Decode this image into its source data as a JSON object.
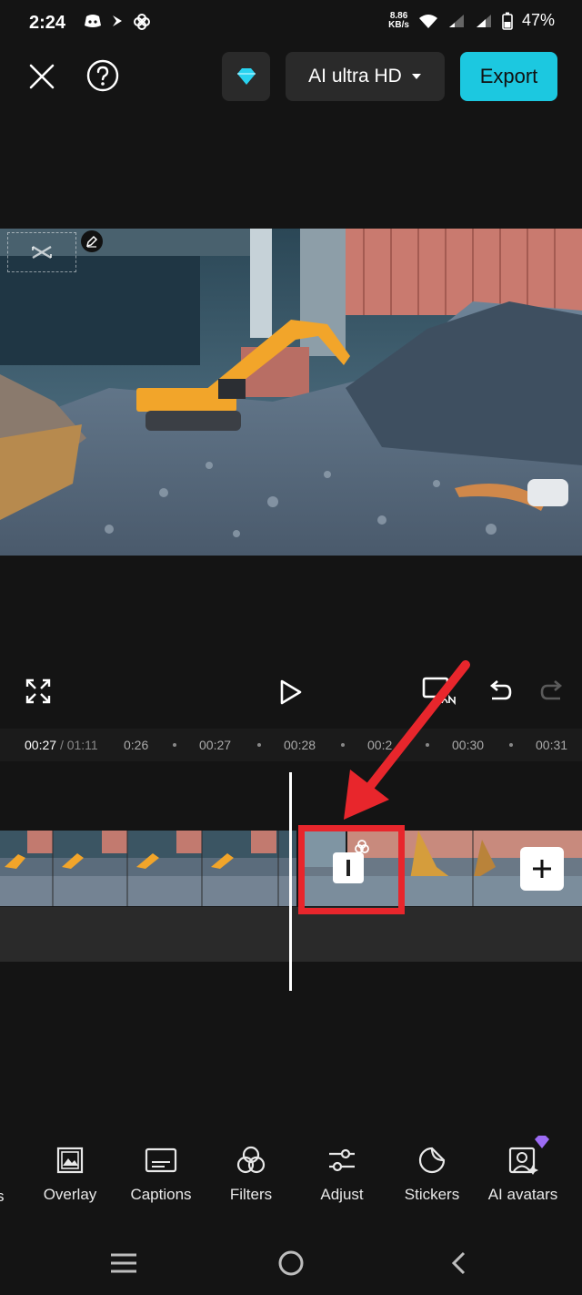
{
  "status_bar": {
    "time": "2:24",
    "net_speed_value": "8.86",
    "net_speed_unit": "KB/s",
    "battery": "47%"
  },
  "top_bar": {
    "quality_label": "AI ultra HD",
    "export_label": "Export"
  },
  "timeline": {
    "current_time": "00:27",
    "total_time": "/ 01:11",
    "ticks": [
      "0:26",
      "00:27",
      "00:28",
      "00:2",
      "00:30",
      "00:31"
    ]
  },
  "toolbar": {
    "partial_label": "s",
    "items": [
      {
        "label": "Overlay"
      },
      {
        "label": "Captions"
      },
      {
        "label": "Filters"
      },
      {
        "label": "Adjust"
      },
      {
        "label": "Stickers"
      },
      {
        "label": "AI avatars"
      }
    ]
  },
  "colors": {
    "accent": "#1cc8e0",
    "highlight": "#e8262c",
    "background": "#141414"
  }
}
